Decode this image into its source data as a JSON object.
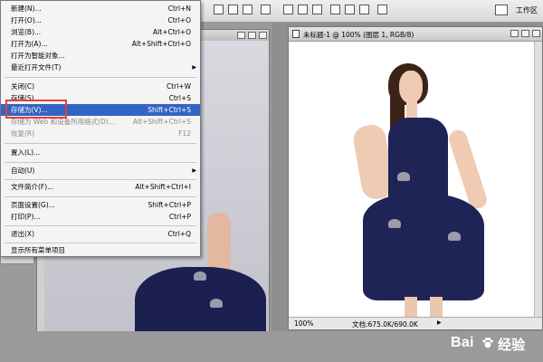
{
  "toolbar": {
    "workspace_label": "工作区"
  },
  "menu": {
    "items": [
      {
        "label": "新建(N)...",
        "shortcut": "Ctrl+N"
      },
      {
        "label": "打开(O)...",
        "shortcut": "Ctrl+O"
      },
      {
        "label": "浏览(B)...",
        "shortcut": "Alt+Ctrl+O"
      },
      {
        "label": "打开为(A)...",
        "shortcut": "Alt+Shift+Ctrl+O"
      },
      {
        "label": "打开为智能对象...",
        "shortcut": ""
      },
      {
        "label": "最近打开文件(T)",
        "shortcut": "",
        "submenu": true
      },
      {
        "label": "关闭(C)",
        "shortcut": "Ctrl+W"
      },
      {
        "label": "存储(S)",
        "shortcut": "Ctrl+S"
      },
      {
        "label": "存储为(V)...",
        "shortcut": "Shift+Ctrl+S",
        "highlighted": true
      },
      {
        "label": "存储为 Web 和设备所用格式(D)...",
        "shortcut": "Alt+Shift+Ctrl+S",
        "disabled": true
      },
      {
        "label": "恢复(R)",
        "shortcut": "F12",
        "disabled": true
      },
      {
        "label": "置入(L)...",
        "shortcut": ""
      },
      {
        "label": "自动(U)",
        "shortcut": "",
        "submenu": true
      },
      {
        "label": "文件简介(F)...",
        "shortcut": "Alt+Shift+Ctrl+I"
      },
      {
        "label": "页面设置(G)...",
        "shortcut": "Shift+Ctrl+P"
      },
      {
        "label": "打印(P)...",
        "shortcut": "Ctrl+P"
      },
      {
        "label": "退出(X)",
        "shortcut": "Ctrl+Q"
      },
      {
        "label": "显示所有菜单项目",
        "shortcut": ""
      }
    ]
  },
  "document": {
    "title": "未标题-1 @ 100% (图层 1, RGB/8)",
    "zoom": "100%",
    "doc_size": "文档:675.0K/690.0K"
  },
  "watermark": {
    "text": "Bai",
    "suffix": "经验"
  },
  "colors": {
    "menu_highlight": "#3264c4",
    "annotation_red": "#e5403a",
    "dress_navy": "#1f2456"
  }
}
